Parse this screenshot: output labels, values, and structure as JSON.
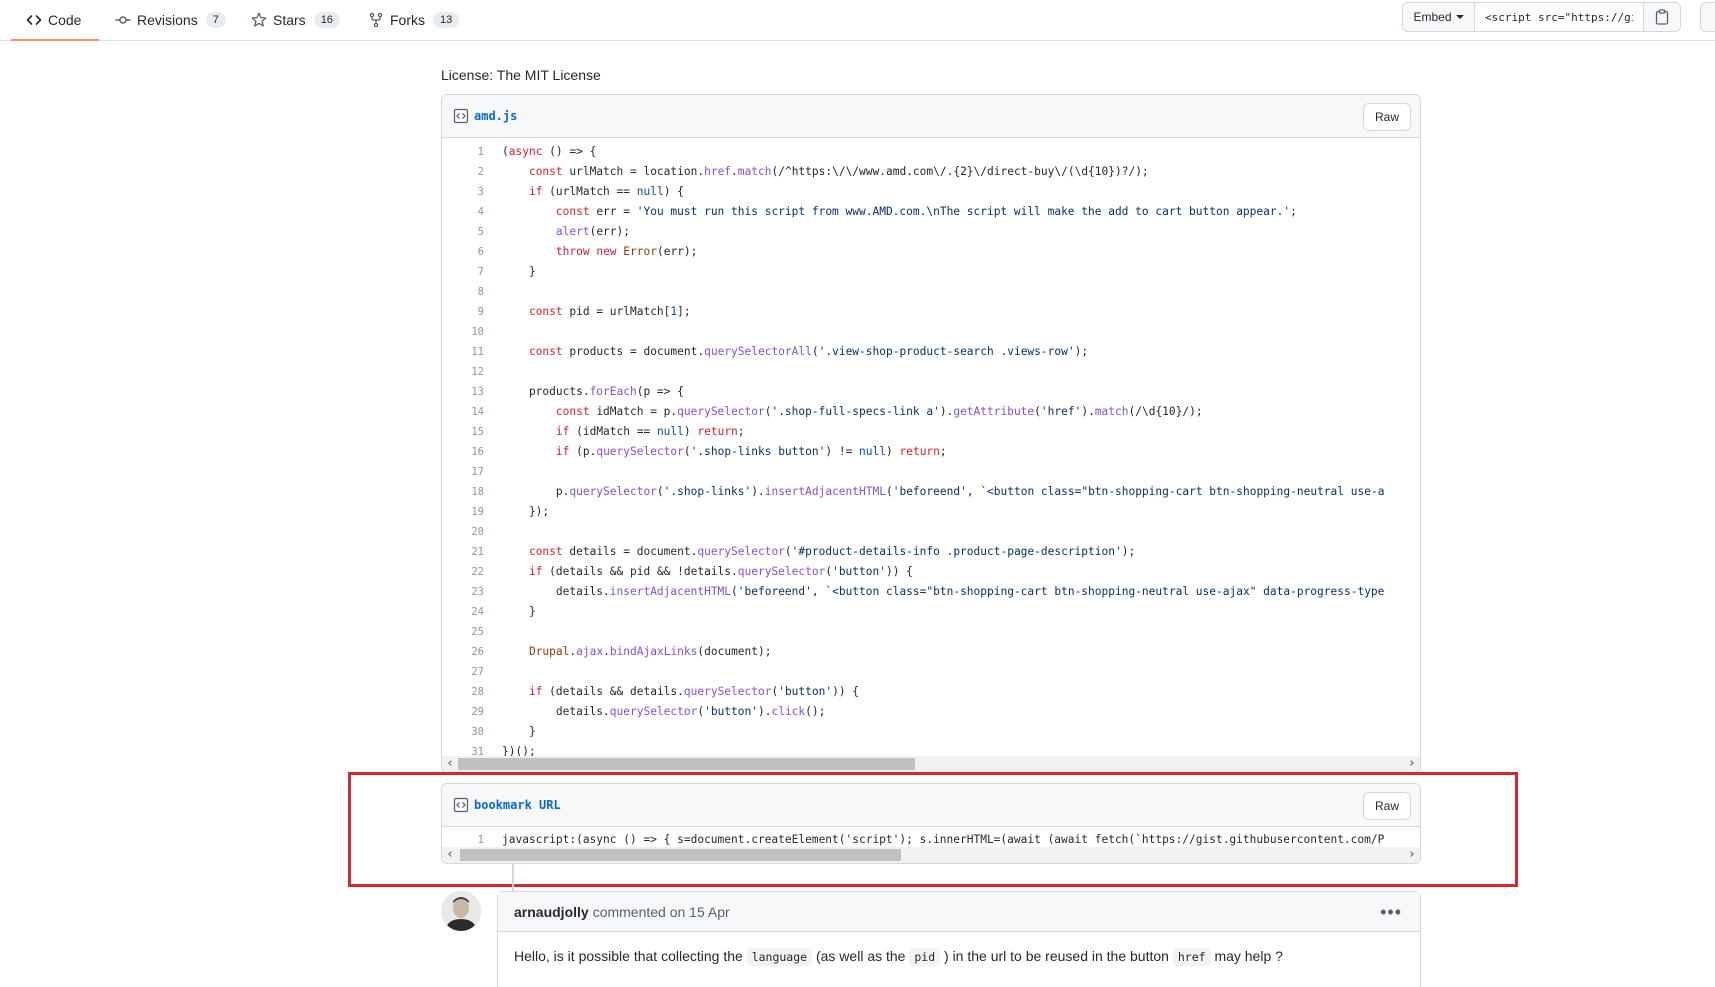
{
  "nav": {
    "code_label": "Code",
    "revisions_label": "Revisions",
    "revisions_count": "7",
    "stars_label": "Stars",
    "stars_count": "16",
    "forks_label": "Forks",
    "forks_count": "13"
  },
  "embed": {
    "button_label": "Embed",
    "input_value": "<script src=\"https://gist.github.com/"
  },
  "license": "License: The MIT License",
  "files": {
    "amd": {
      "name": "amd.js",
      "raw_label": "Raw",
      "line_numbers": [
        "1",
        "2",
        "3",
        "4",
        "5",
        "6",
        "7",
        "8",
        "9",
        "10",
        "11",
        "12",
        "13",
        "14",
        "15",
        "16",
        "17",
        "18",
        "19",
        "20",
        "21",
        "22",
        "23",
        "24",
        "25",
        "26",
        "27",
        "28",
        "29",
        "30",
        "31"
      ]
    },
    "bookmark": {
      "name": "bookmark URL",
      "raw_label": "Raw",
      "line_number": "1",
      "line": "javascript:(async () => { s=document.createElement('script'); s.innerHTML=(await (await fetch(`https://gist.githubusercontent.com/P"
    }
  },
  "comment": {
    "author": "arnaudjolly",
    "meta": "commented on 15 Apr",
    "text_1": "Hello, is it possible that collecting the",
    "code_1": "language",
    "text_2": "(as well as the",
    "code_2": "pid",
    "text_3": ") in the url to be reused in the button",
    "code_3": "href",
    "text_4": "may help ?"
  },
  "code_lines": [
    "(async () => {",
    "    const urlMatch = location.href.match(/^https:\\/\\/www.amd.com\\/.{2}\\/direct-buy\\/(\\d{10})?/);",
    "    if (urlMatch == null) {",
    "        const err = 'You must run this script from www.AMD.com.\\nThe script will make the add to cart button appear.';",
    "        alert(err);",
    "        throw new Error(err);",
    "    }",
    "",
    "    const pid = urlMatch[1];",
    "",
    "    const products = document.querySelectorAll('.view-shop-product-search .views-row');",
    "",
    "    products.forEach(p => {",
    "        const idMatch = p.querySelector('.shop-full-specs-link a').getAttribute('href').match(/\\d{10}/);",
    "        if (idMatch == null) return;",
    "        if (p.querySelector('.shop-links button') != null) return;",
    "",
    "        p.querySelector('.shop-links').insertAdjacentHTML('beforeend', `<button class=\"btn-shopping-cart btn-shopping-neutral use-a",
    "    });",
    "",
    "    const details = document.querySelector('#product-details-info .product-page-description');",
    "    if (details && pid && !details.querySelector('button')) {",
    "        details.insertAdjacentHTML('beforeend', `<button class=\"btn-shopping-cart btn-shopping-neutral use-ajax\" data-progress-type",
    "    }",
    "",
    "    Drupal.ajax.bindAjaxLinks(document);",
    "",
    "    if (details && details.querySelector('button')) {",
    "        details.querySelector('button').click();",
    "    }",
    "})();"
  ]
}
